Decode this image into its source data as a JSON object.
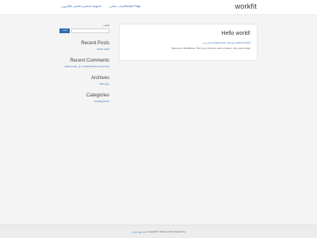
{
  "header": {
    "site_title": "workfit",
    "nav": [
      {
        "label": "Sample Page"
      },
      {
        "label": "حساب عملائي"
      },
      {
        "label": "الدفع"
      },
      {
        "label": "سلة المشتريات"
      },
      {
        "label": "المتجر الإلكتروني"
      }
    ]
  },
  "sidebar": {
    "search_label": "البحث",
    "search_button": "البحث",
    "recent_posts": {
      "title": "Recent Posts",
      "items": [
        "!Hello world"
      ]
    },
    "recent_comments": {
      "title": "Recent Comments",
      "items": [
        "Hello world! على A WordPress Commenter"
      ]
    },
    "archives": {
      "title": "Archives",
      "items": [
        "مايو 2021"
      ]
    },
    "categories": {
      "title": "Categories",
      "items": [
        "Uncategorized"
      ]
    }
  },
  "post": {
    "title": "!Hello world",
    "meta": "نشر في Uncategorized | بواسطة workfitcom2021",
    "excerpt": "Welcome to WordPress. This is your first post. Edit or delete it, then start writing!"
  },
  "footer": {
    "text": "Copyright © 2021 workfit | Powered by",
    "link": "مدونة ووردبريس"
  },
  "colors": {
    "accent": "#2b6cb0",
    "background": "#f4f4f4"
  }
}
